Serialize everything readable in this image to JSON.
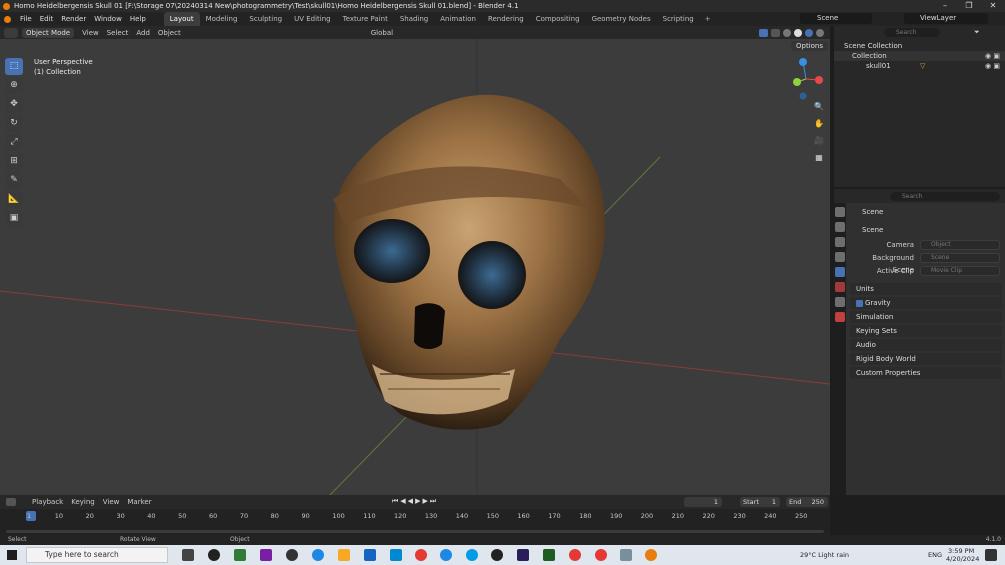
{
  "window": {
    "title": "Homo Heidelbergensis Skull 01 [F:\\Storage 07\\20240314 New\\photogrammetry\\Test\\skull01\\Homo Heidelbergensis Skull 01.blend] - Blender 4.1"
  },
  "menubar": {
    "menus": [
      "File",
      "Edit",
      "Render",
      "Window",
      "Help"
    ],
    "workspaces": [
      "Layout",
      "Modeling",
      "Sculpting",
      "UV Editing",
      "Texture Paint",
      "Shading",
      "Animation",
      "Rendering",
      "Compositing",
      "Geometry Nodes",
      "Scripting"
    ],
    "active_workspace": "Layout",
    "scene": "Scene",
    "view_layer": "ViewLayer"
  },
  "viewport_header": {
    "mode": "Object Mode",
    "menus": [
      "View",
      "Select",
      "Add",
      "Object"
    ],
    "transform_orientation": "Global",
    "options": "Options"
  },
  "viewport": {
    "perspective_label": "User Perspective",
    "collection_label": "(1) Collection",
    "gizmo_axes": [
      "X",
      "Y",
      "Z"
    ]
  },
  "outliner": {
    "search_placeholder": "Search",
    "rows": [
      "Scene Collection",
      "Collection",
      "skull01"
    ]
  },
  "properties": {
    "search_placeholder": "Search",
    "breadcrumb": "Scene",
    "section": "Scene",
    "fields": [
      {
        "label": "Camera",
        "value": "Object"
      },
      {
        "label": "Background Scene",
        "value": "Scene"
      },
      {
        "label": "Active Clip",
        "value": "Movie Clip"
      }
    ],
    "panels": [
      "Units",
      "Gravity",
      "Simulation",
      "Keying Sets",
      "Audio",
      "Rigid Body World",
      "Custom Properties"
    ],
    "gravity_checked": true
  },
  "timeline": {
    "menus": [
      "Playback",
      "Keying",
      "View",
      "Marker"
    ],
    "current_frame": "1",
    "start_label": "Start",
    "start": "1",
    "end_label": "End",
    "end": "250",
    "ticks": [
      "1",
      "10",
      "20",
      "30",
      "40",
      "50",
      "60",
      "70",
      "80",
      "90",
      "100",
      "110",
      "120",
      "130",
      "140",
      "150",
      "160",
      "170",
      "180",
      "190",
      "200",
      "210",
      "220",
      "230",
      "240",
      "250"
    ]
  },
  "statusbar": {
    "left": "Select",
    "middle": "Rotate View",
    "right": "Object",
    "version": "4.1.0"
  },
  "taskbar": {
    "search_placeholder": "Type here to search",
    "weather": "29°C  Light rain",
    "language": "ENG",
    "time": "3:59 PM",
    "date": "4/20/2024"
  },
  "colors": {
    "accent": "#4772b3",
    "blender_orange": "#e87d0d",
    "x_axis": "#e84a4a",
    "y_axis": "#8cd43b",
    "z_axis": "#3a8fe0"
  }
}
